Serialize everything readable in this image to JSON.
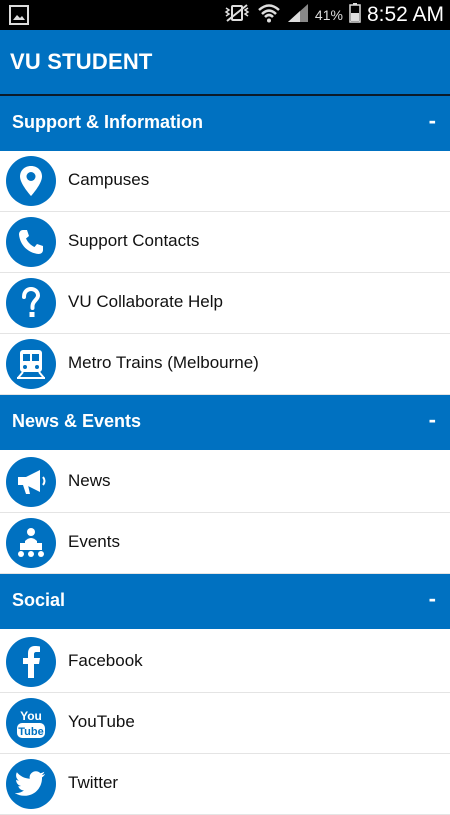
{
  "status_bar": {
    "battery_percent": "41%",
    "time": "8:52 AM",
    "icons": [
      "image-icon",
      "no-vibrate-icon",
      "wifi-icon",
      "signal-icon",
      "battery-icon"
    ]
  },
  "app_bar": {
    "title": "VU STUDENT"
  },
  "sections": [
    {
      "title": "Support & Information",
      "toggle": "-",
      "items": [
        {
          "label": "Campuses",
          "icon": "location-pin-icon"
        },
        {
          "label": "Support Contacts",
          "icon": "phone-icon"
        },
        {
          "label": "VU Collaborate Help",
          "icon": "question-icon"
        },
        {
          "label": "Metro Trains (Melbourne)",
          "icon": "train-icon"
        }
      ]
    },
    {
      "title": "News & Events",
      "toggle": "-",
      "items": [
        {
          "label": "News",
          "icon": "megaphone-icon"
        },
        {
          "label": "Events",
          "icon": "presenter-icon"
        }
      ]
    },
    {
      "title": "Social",
      "toggle": "-",
      "items": [
        {
          "label": "Facebook",
          "icon": "facebook-icon"
        },
        {
          "label": "YouTube",
          "icon": "youtube-icon"
        },
        {
          "label": "Twitter",
          "icon": "twitter-icon"
        }
      ]
    }
  ],
  "youtube_icon_text": {
    "line1": "You",
    "line2": "Tube"
  },
  "colors": {
    "brand_blue": "#0071c1",
    "status_bar": "#000000",
    "row_background": "#ffffff",
    "divider": "#e4e4e4"
  }
}
